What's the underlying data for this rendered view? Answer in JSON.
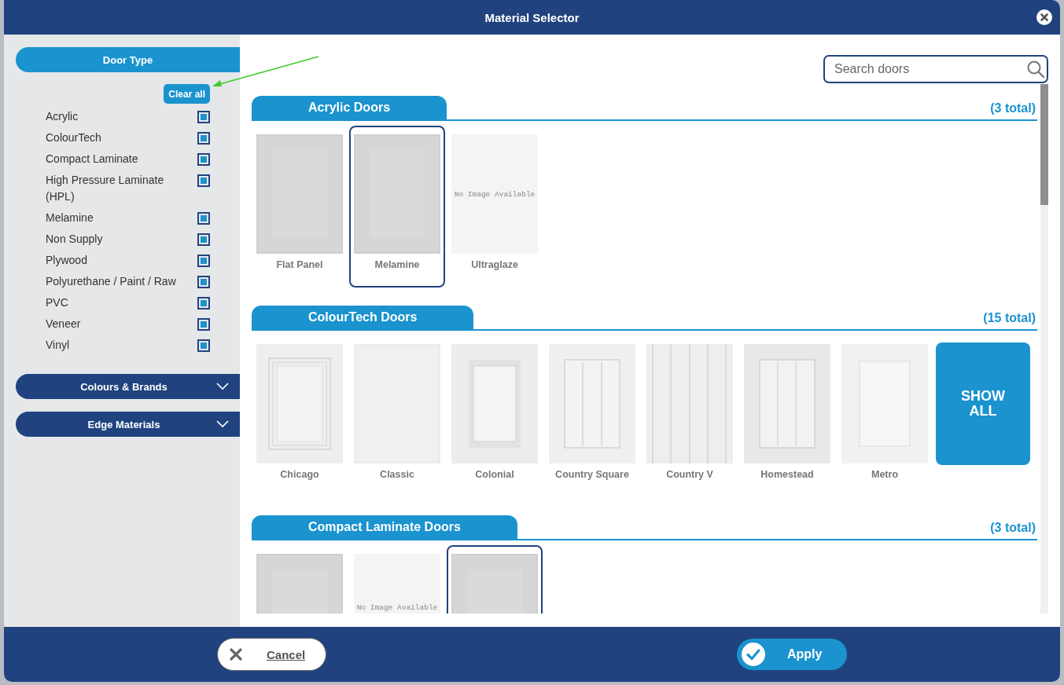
{
  "window": {
    "title": "Material Selector"
  },
  "sidebar": {
    "door_type": {
      "title": "Door Type",
      "clear_button": "Clear all",
      "options": [
        {
          "label": "Acrylic",
          "checked": true
        },
        {
          "label": "ColourTech",
          "checked": true
        },
        {
          "label": "Compact Laminate",
          "checked": true
        },
        {
          "label": "High Pressure Laminate (HPL)",
          "checked": true
        },
        {
          "label": "Melamine",
          "checked": true
        },
        {
          "label": "Non Supply",
          "checked": true
        },
        {
          "label": "Plywood",
          "checked": true
        },
        {
          "label": "Polyurethane / Paint / Raw",
          "checked": true
        },
        {
          "label": "PVC",
          "checked": true
        },
        {
          "label": "Veneer",
          "checked": true
        },
        {
          "label": "Vinyl",
          "checked": true
        }
      ]
    },
    "panels": [
      {
        "title": "Colours & Brands",
        "expanded": false
      },
      {
        "title": "Edge Materials",
        "expanded": false
      }
    ]
  },
  "search": {
    "placeholder": "Search doors"
  },
  "sections": [
    {
      "title": "Acrylic Doors",
      "count": "(3 total)",
      "doors": [
        {
          "name": "Flat Panel",
          "kind": "grey",
          "selected": false
        },
        {
          "name": "Melamine",
          "kind": "grey",
          "selected": true
        },
        {
          "name": "Ultraglaze",
          "kind": "none",
          "placeholder": "No Image Available",
          "selected": false
        }
      ]
    },
    {
      "title": "ColourTech Doors",
      "count": "(15 total)",
      "show_all": "SHOW ALL",
      "doors": [
        {
          "name": "Chicago",
          "kind": "chicago",
          "selected": false
        },
        {
          "name": "Classic",
          "kind": "white",
          "selected": false
        },
        {
          "name": "Colonial",
          "kind": "colonial",
          "selected": false
        },
        {
          "name": "Country Square",
          "kind": "square",
          "selected": false
        },
        {
          "name": "Country V",
          "kind": "grooved",
          "selected": false
        },
        {
          "name": "Homestead",
          "kind": "panelled",
          "selected": false
        },
        {
          "name": "Metro",
          "kind": "inset",
          "selected": false
        }
      ]
    },
    {
      "title": "Compact Laminate Doors",
      "count": "(3 total)",
      "doors": [
        {
          "kind": "grey",
          "selected": false
        },
        {
          "kind": "none",
          "placeholder": "No Image Available",
          "selected": false
        },
        {
          "kind": "grey",
          "selected": true
        }
      ]
    }
  ],
  "footer": {
    "cancel": "Cancel",
    "apply": "Apply"
  }
}
